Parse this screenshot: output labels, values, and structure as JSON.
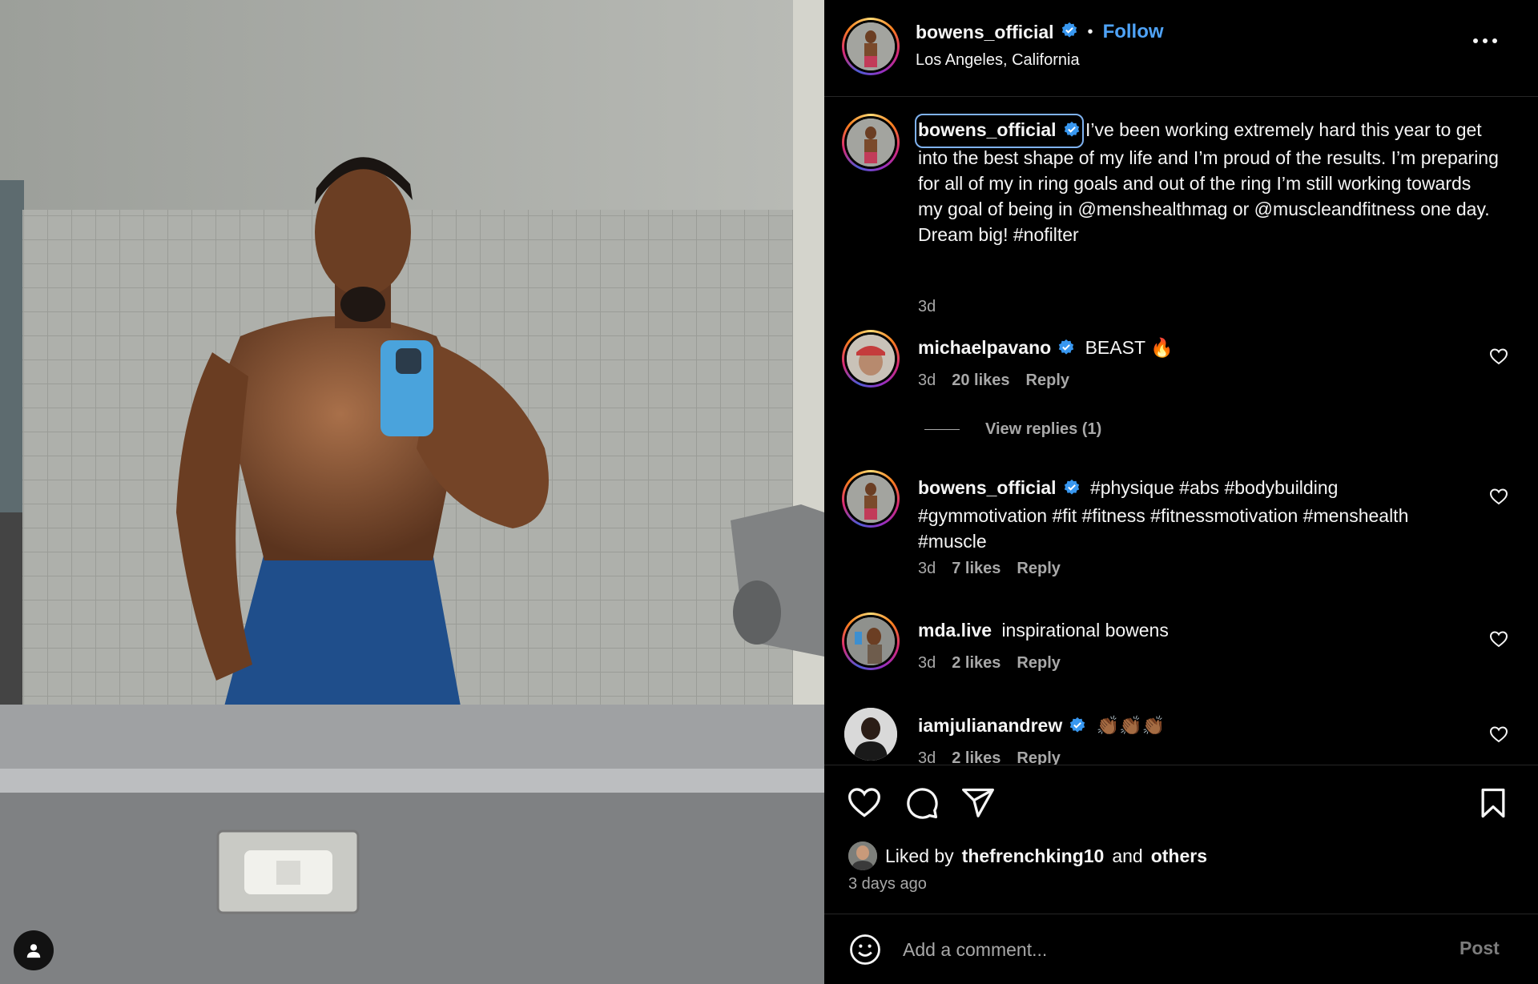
{
  "post": {
    "author": "bowens_official",
    "follow_label": "Follow",
    "separator": "•",
    "location": "Los Angeles, California",
    "caption": {
      "user": "bowens_official",
      "text": "I’ve been working extremely hard this year to get into the best shape of my life and I’m proud of the results. I’m preparing for all of my in ring goals and out of the ring I’m still working towards my goal of being in @menshealthmag or @muscleandfitness one day. Dream big! #nofilter",
      "age": "3d"
    }
  },
  "comments": [
    {
      "user": "michaelpavano",
      "verified": true,
      "text": "BEAST 🔥",
      "age": "3d",
      "likes": "20 likes",
      "reply": "Reply",
      "view_replies": "View replies (1)"
    },
    {
      "user": "bowens_official",
      "verified": true,
      "text": "#physique #abs #bodybuilding #gymmotivation #fit #fitness #fitnessmotivation #menshealth #muscle",
      "age": "3d",
      "likes": "7 likes",
      "reply": "Reply"
    },
    {
      "user": "mda.live",
      "verified": false,
      "text": "inspirational bowens",
      "age": "3d",
      "likes": "2 likes",
      "reply": "Reply"
    },
    {
      "user": "iamjulianandrew",
      "verified": true,
      "text": "👏🏾👏🏾👏🏾",
      "age": "3d",
      "likes": "2 likes",
      "reply": "Reply"
    }
  ],
  "footer": {
    "liked_prefix": "Liked by",
    "liked_user": "thefrenchking10",
    "liked_and": "and",
    "liked_others": "others",
    "timestamp": "3 days ago",
    "comment_placeholder": "Add a comment...",
    "post_label": "Post"
  },
  "icons": {
    "heart": "heart-icon",
    "comment": "comment-icon",
    "share": "share-icon",
    "save": "bookmark-icon",
    "emoji": "emoji-icon",
    "more": "more-icon",
    "verified": "verified-badge-icon",
    "user_tag": "user-tag-icon"
  },
  "colors": {
    "accent": "#4fa3f7",
    "background": "#000000",
    "secondary_text": "#a8a8a8"
  }
}
